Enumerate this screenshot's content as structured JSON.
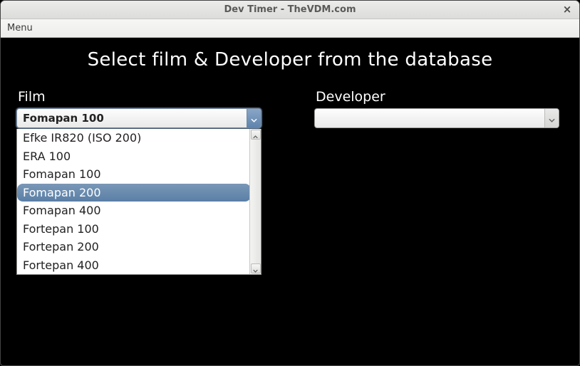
{
  "window": {
    "title": "Dev Timer - TheVDM.com"
  },
  "menubar": {
    "items": [
      {
        "label": "Menu"
      }
    ]
  },
  "headline": "Select film & Developer from the database",
  "film": {
    "label": "Film",
    "selected": "Fomapan 100",
    "options": [
      "Efke IR820 (ISO 200)",
      "ERA 100",
      "Fomapan 100",
      "Fomapan 200",
      "Fomapan 400",
      "Fortepan 100",
      "Fortepan 200",
      "Fortepan 400"
    ],
    "highlighted_index": 3
  },
  "developer": {
    "label": "Developer",
    "selected": ""
  }
}
